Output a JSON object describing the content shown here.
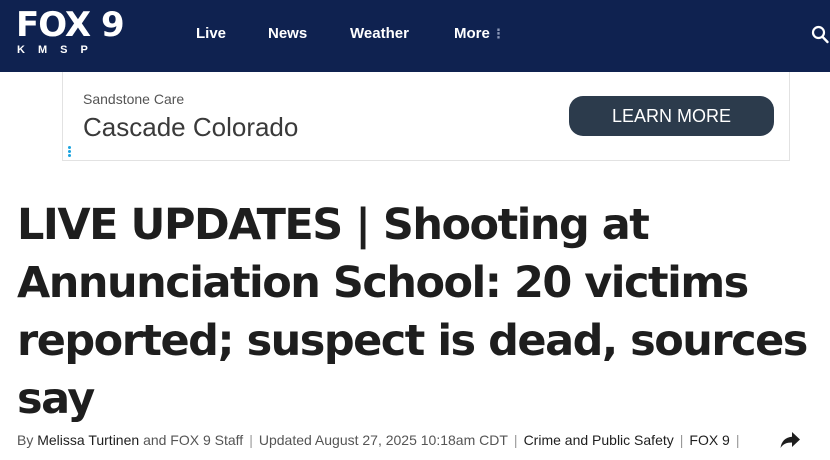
{
  "header": {
    "logo": {
      "main": "FOX 9",
      "sub": "KMSP"
    },
    "nav": [
      {
        "label": "Live"
      },
      {
        "label": "News"
      },
      {
        "label": "Weather"
      },
      {
        "label": "More"
      }
    ],
    "more_dots": "⋮",
    "search_icon": "search-icon",
    "background": "#0f2250"
  },
  "ad": {
    "sponsor": "Sandstone Care",
    "headline": "Cascade Colorado",
    "cta_label": "LEARN MORE",
    "cta_color": "#2c3b4c"
  },
  "article": {
    "headline": "LIVE UPDATES | Shooting at Annunciation School: 20 victims reported; suspect is dead, sources say",
    "byline": {
      "by": "By",
      "author": "Melissa Turtinen",
      "and_staff": "and FOX 9 Staff",
      "updated_label": "Updated",
      "updated_time": "August 27, 2025 10:18am CDT",
      "category": "Crime and Public Safety",
      "source": "FOX 9",
      "separator": "|",
      "share_icon": "share-icon"
    }
  }
}
